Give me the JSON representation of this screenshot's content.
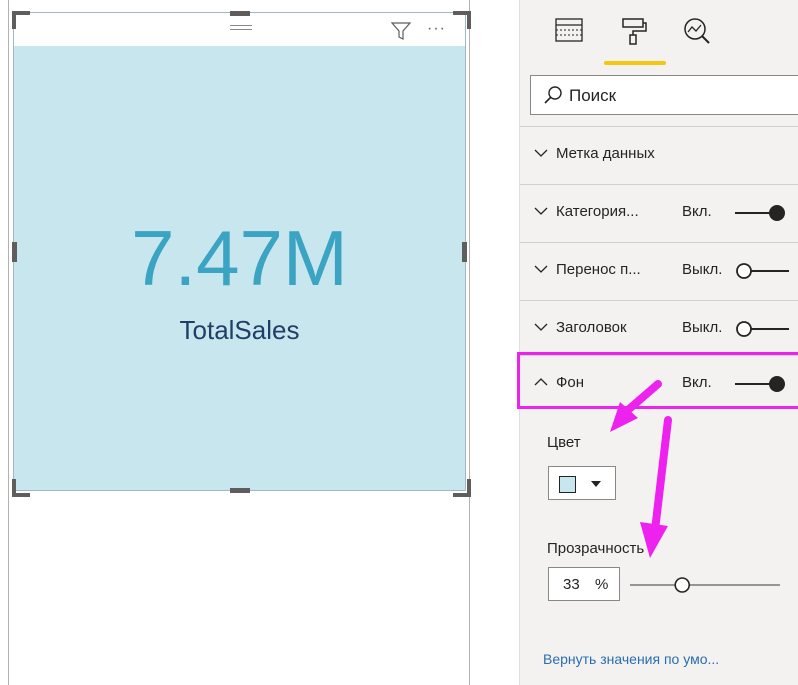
{
  "card": {
    "value": "7.47M",
    "label": "TotalSales",
    "background_color": "#c8e6ee",
    "value_color": "#3aa4c2",
    "label_color": "#1f3f66",
    "header_icons": [
      "drag-grip-icon",
      "filter-icon",
      "more-options-icon"
    ],
    "more_glyph": "···"
  },
  "format_pane": {
    "tabs": [
      {
        "icon": "fields-icon"
      },
      {
        "icon": "format-paint-roller-icon",
        "active": true
      },
      {
        "icon": "analytics-icon"
      }
    ],
    "search": {
      "placeholder": "Поиск"
    },
    "sections": [
      {
        "title": "Метка данных",
        "state": "",
        "expanded": false
      },
      {
        "title": "Категория...",
        "state": "Вкл.",
        "on": true,
        "expanded": false
      },
      {
        "title": "Перенос п...",
        "state": "Выкл.",
        "on": false,
        "expanded": false
      },
      {
        "title": "Заголовок",
        "state": "Выкл.",
        "on": false,
        "expanded": false
      },
      {
        "title": "Фон",
        "state": "Вкл.",
        "on": true,
        "expanded": true
      }
    ],
    "background": {
      "color_label": "Цвет",
      "color_value": "#c8e6ee",
      "transparency_label": "Прозрачность",
      "transparency_value": "33",
      "transparency_unit": "%",
      "transparency_percent": 33
    },
    "reset_link": "Вернуть значения по умо...",
    "accent_color": "#f2c811",
    "highlight_color": "#ee22ee"
  }
}
